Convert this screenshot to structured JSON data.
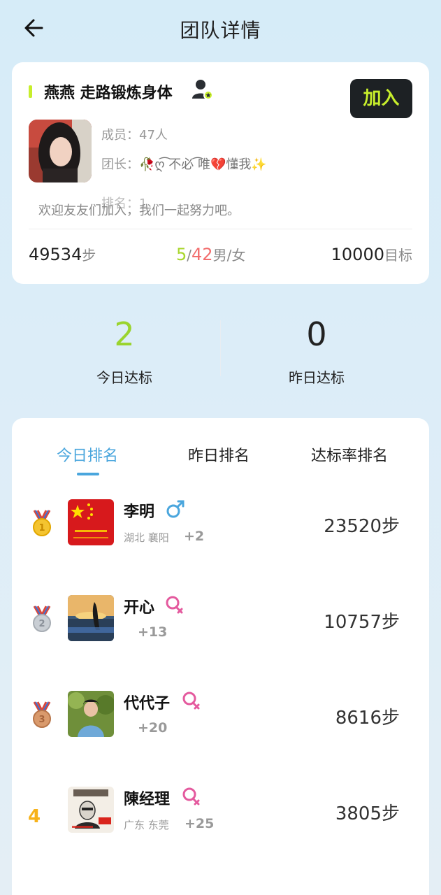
{
  "header": {
    "title": "团队详情"
  },
  "team": {
    "name": "燕燕 走路锻炼身体",
    "join_label": "加入",
    "members": "成员：47人",
    "leader_prefix": "团长：",
    "leader_name": "🥀ღ͡ 不必 ͡唯💔懂我✨",
    "rank": "排名：1",
    "welcome": "欢迎友友们加入，我们一起努力吧。",
    "steps_value": "49534",
    "steps_unit": "步",
    "male_count": "5",
    "gender_sep": "/",
    "female_count": "42",
    "gender_unit": "男/女",
    "goal_value": "10000",
    "goal_unit": "目标"
  },
  "daily": {
    "today_value": "2",
    "today_label": "今日达标",
    "yesterday_value": "0",
    "yesterday_label": "昨日达标"
  },
  "tabs": {
    "today": "今日排名",
    "yesterday": "昨日排名",
    "rate": "达标率排名"
  },
  "ranking": [
    {
      "rank": "1",
      "name": "李明",
      "gender": "male",
      "location": "湖北 襄阳",
      "plus": "+2",
      "steps": "23520步"
    },
    {
      "rank": "2",
      "name": "开心",
      "gender": "female",
      "location": "",
      "plus": "+13",
      "steps": "10757步"
    },
    {
      "rank": "3",
      "name": "代代子",
      "gender": "female",
      "location": "",
      "plus": "+20",
      "steps": "8616步"
    },
    {
      "rank": "4",
      "name": "陳经理",
      "gender": "female",
      "location": "广东 东莞",
      "plus": "+25",
      "steps": "3805步"
    }
  ],
  "colors": {
    "accent_green": "#c7ee2c",
    "tab_blue": "#4aa6dd",
    "male_blue": "#4aa6dd",
    "female_pink": "#e45a9e",
    "rank4_orange": "#f7b21a"
  },
  "icons": [
    "back-arrow-icon",
    "team-leader-icon",
    "gold-medal-icon",
    "silver-medal-icon",
    "bronze-medal-icon",
    "male-icon",
    "female-icon"
  ]
}
